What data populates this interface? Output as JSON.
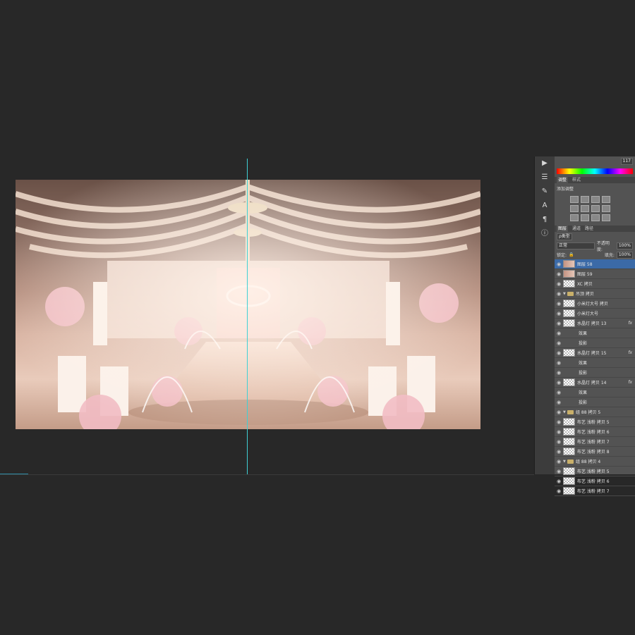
{
  "adjustments_panel": {
    "tabs": [
      "调整",
      "样式"
    ],
    "add_adjustment_label": "添加调整"
  },
  "top_value": "117",
  "layers_panel": {
    "tabs": [
      "图层",
      "通道",
      "路径"
    ],
    "filter_label": "ρ类型",
    "blend_mode": "正常",
    "opacity_label": "不透明度:",
    "opacity_value": "100%",
    "lock_label": "锁定:",
    "fill_label": "填充:",
    "fill_value": "100%",
    "layers": [
      {
        "name": "图层 58",
        "kind": "layer"
      },
      {
        "name": "图层 59",
        "kind": "layer"
      },
      {
        "name": "XC 拷贝",
        "kind": "layer"
      },
      {
        "name": "吊顶 拷贝",
        "kind": "group"
      },
      {
        "name": "小米灯大号 拷贝",
        "kind": "layer"
      },
      {
        "name": "小米灯大号",
        "kind": "layer"
      },
      {
        "name": "水晶灯 拷贝 13",
        "kind": "layer",
        "fx": "fx"
      },
      {
        "name": "效果",
        "kind": "effect"
      },
      {
        "name": "投影",
        "kind": "effect"
      },
      {
        "name": "水晶灯 拷贝 15",
        "kind": "layer",
        "fx": "fx"
      },
      {
        "name": "效果",
        "kind": "effect"
      },
      {
        "name": "投影",
        "kind": "effect"
      },
      {
        "name": "水晶灯 拷贝 14",
        "kind": "layer",
        "fx": "fx"
      },
      {
        "name": "效果",
        "kind": "effect"
      },
      {
        "name": "投影",
        "kind": "effect"
      },
      {
        "name": "组 88 拷贝 5",
        "kind": "group"
      },
      {
        "name": "布艺 浅粉 拷贝 5",
        "kind": "layer"
      },
      {
        "name": "布艺 浅粉 拷贝 6",
        "kind": "layer"
      },
      {
        "name": "布艺 浅粉 拷贝 7",
        "kind": "layer"
      },
      {
        "name": "布艺 浅粉 拷贝 8",
        "kind": "layer"
      },
      {
        "name": "组 88 拷贝 4",
        "kind": "group"
      },
      {
        "name": "布艺 浅粉 拷贝 5",
        "kind": "layer"
      },
      {
        "name": "布艺 浅粉 拷贝 6",
        "kind": "layer"
      },
      {
        "name": "布艺 浅粉 拷贝 7",
        "kind": "layer"
      }
    ]
  }
}
